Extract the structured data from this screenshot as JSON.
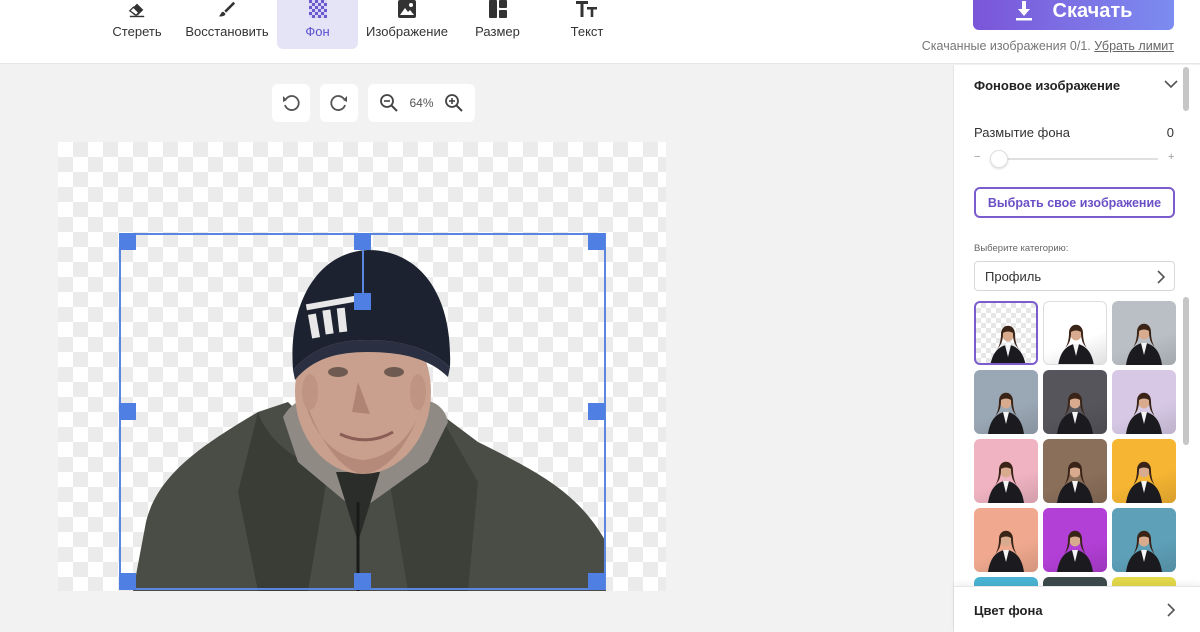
{
  "toolbar": {
    "tools": [
      {
        "label": "Стереть",
        "icon": "eraser-icon"
      },
      {
        "label": "Восстановить",
        "icon": "brush-icon"
      },
      {
        "label": "Фон",
        "icon": "checkerboard-icon",
        "active": true
      },
      {
        "label": "Изображение",
        "icon": "image-icon"
      },
      {
        "label": "Размер",
        "icon": "layout-icon"
      },
      {
        "label": "Текст",
        "icon": "text-icon"
      }
    ],
    "download_label": "Скачать",
    "limit_text": "Скачанные изображения 0/1.",
    "limit_link": "Убрать лимит"
  },
  "canvas_controls": {
    "zoom": "64%"
  },
  "panel": {
    "bg_image_title": "Фоновое изображение",
    "blur_label": "Размытие фона",
    "blur_value": "0",
    "slider_minus": "−",
    "slider_plus": "+",
    "own_image_button": "Выбрать свое изображение",
    "category_label": "Выберите категорию:",
    "category_value": "Профиль",
    "thumbnails": [
      {
        "bg": "transparent"
      },
      {
        "bg": "#ffffff"
      },
      {
        "bg": "#b9bfc4"
      },
      {
        "bg": "#9aa7b4"
      },
      {
        "bg": "#55555b"
      },
      {
        "bg": "#d7c9e6"
      },
      {
        "bg": "#f0b3c2"
      },
      {
        "bg": "#8a6f5a"
      },
      {
        "bg": "#f6b532"
      },
      {
        "bg": "#f0a98f"
      },
      {
        "bg": "#b23fd6"
      },
      {
        "bg": "#5ea0b8"
      },
      {
        "bg": "#4ab3d3"
      },
      {
        "bg": "#3d4a4c"
      },
      {
        "bg": "#e3d84a"
      }
    ],
    "bg_color_title": "Цвет фона"
  },
  "colors": {
    "accent": "#7b5ccd",
    "selection": "#4f7fe3",
    "download_gradient_start": "#7b55d8",
    "download_gradient_end": "#7c8cf0"
  }
}
